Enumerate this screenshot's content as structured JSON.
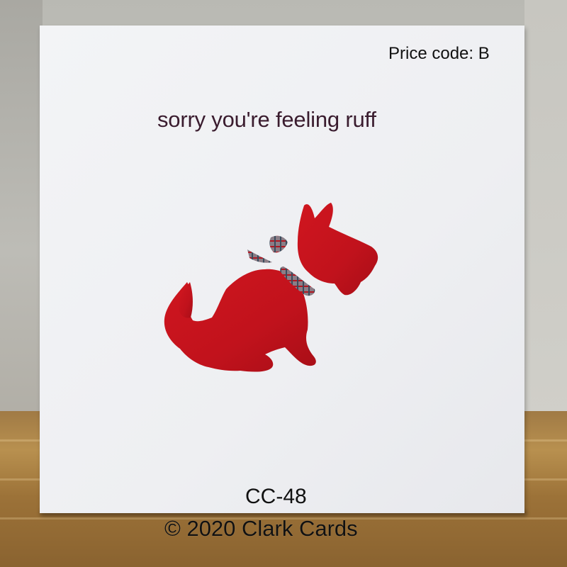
{
  "card": {
    "price_code": "Price code: B",
    "message": "sorry you're feeling ruff",
    "illustration_icon": "scottie-dog-cutout-icon"
  },
  "caption": {
    "product_code": "CC-48",
    "copyright": "© 2020 Clark Cards"
  },
  "colors": {
    "card": "#eeeff2",
    "dog": "#c1121c",
    "message_text": "#3a1c2e",
    "table": "#a07a45"
  }
}
